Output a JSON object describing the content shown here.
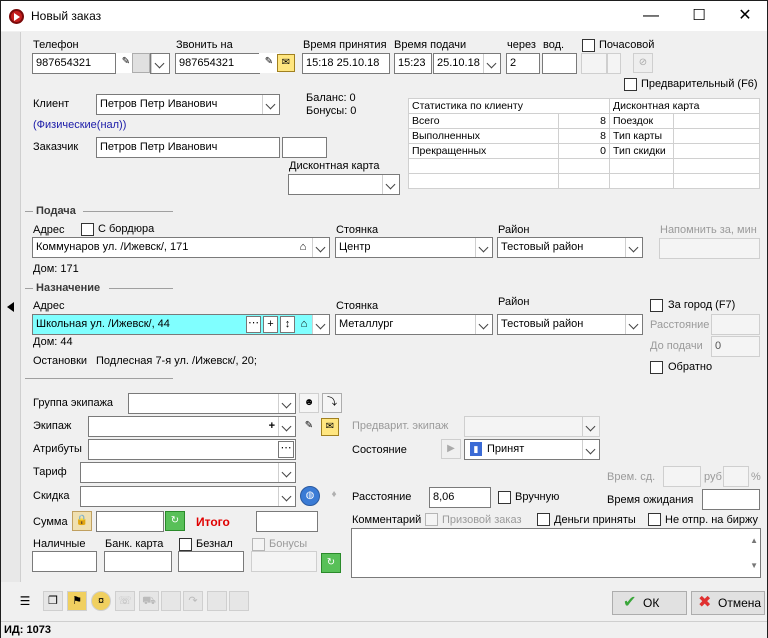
{
  "window": {
    "title": "Новый заказ",
    "minimize": "—",
    "maximize": "☐",
    "close": "✕"
  },
  "header": {
    "phone_label": "Телефон",
    "phone_value": "987654321",
    "call_label": "Звонить на",
    "call_value": "987654321",
    "accept_time_label": "Время принятия",
    "accept_time_value": "15:18 25.10.18",
    "serve_time_label": "Время подачи",
    "serve_time_value": "15:23",
    "serve_date_value": "25.10.18",
    "after_label": "через",
    "after_value": "2",
    "driver_label": "вод.",
    "hourly_label": "Почасовой",
    "preliminary_label": "Предварительный (F6)"
  },
  "client": {
    "client_label": "Клиент",
    "client_value": "Петров Петр Иванович",
    "client_type": "(Физические(нал))",
    "balance": "Баланс: 0",
    "bonuses": "Бонусы: 0",
    "customer_label": "Заказчик",
    "customer_value": "Петров Петр Иванович",
    "discount_card_label": "Дисконтная карта"
  },
  "stats": {
    "header_left": "Статистика по клиенту",
    "header_right": "Дисконтная карта",
    "rows": [
      {
        "name": "Всего",
        "value": "8",
        "card": "Поездок"
      },
      {
        "name": "Выполненных",
        "value": "8",
        "card": "Тип карты"
      },
      {
        "name": "Прекращенных",
        "value": "0",
        "card": "Тип скидки"
      }
    ]
  },
  "pickup": {
    "section": "Подача",
    "address_label": "Адрес",
    "from_curb_label": "С бордюра",
    "address_value": "Коммунаров ул. /Ижевск/, 171",
    "parking_label": "Стоянка",
    "parking_value": "Центр",
    "district_label": "Район",
    "district_value": "Тестовый район",
    "remind_label": "Напомнить за, мин",
    "house": "Дом: 171"
  },
  "destination": {
    "section": "Назначение",
    "address_label": "Адрес",
    "address_value": "Школьная ул. /Ижевск/, 44",
    "parking_label": "Стоянка",
    "parking_value": "Металлург",
    "district_label": "Район",
    "district_value": "Тестовый район",
    "out_of_town_label": "За город (F7)",
    "distance_label": "Расстояние",
    "to_pickup_label": "До подачи",
    "to_pickup_value": "0",
    "back_label": "Обратно",
    "house": "Дом: 44",
    "stops_label": "Остановки",
    "stops_value": "Подлесная 7-я ул. /Ижевск/, 20;"
  },
  "order": {
    "crew_group_label": "Группа экипажа",
    "crew_label": "Экипаж",
    "attributes_label": "Атрибуты",
    "tariff_label": "Тариф",
    "discount_label": "Скидка",
    "sum_label": "Сумма",
    "total_label": "Итого",
    "cash_label": "Наличные",
    "bank_card_label": "Банк. карта",
    "cashless_label": "Безнал",
    "bonuses_label": "Бонусы",
    "prelim_crew_label": "Предварит. экипаж",
    "state_label": "Состояние",
    "state_value": "Принят",
    "wait_time_label": "Врем. сд.",
    "rub_label": "руб",
    "percent_label": "%",
    "distance_label": "Расстояние",
    "distance_value": "8,06",
    "manual_label": "Вручную",
    "wait_label": "Время ожидания",
    "comment_label": "Комментарий",
    "prize_label": "Призовой заказ",
    "money_label": "Деньги приняты",
    "no_exchange_label": "Не отпр. на биржу"
  },
  "footer": {
    "ok": "ОК",
    "cancel": "Отмена",
    "id": "ИД: 1073"
  },
  "colors": {
    "highlight": "#80ffff",
    "red": "#e00000",
    "link": "#1a1aa8"
  }
}
